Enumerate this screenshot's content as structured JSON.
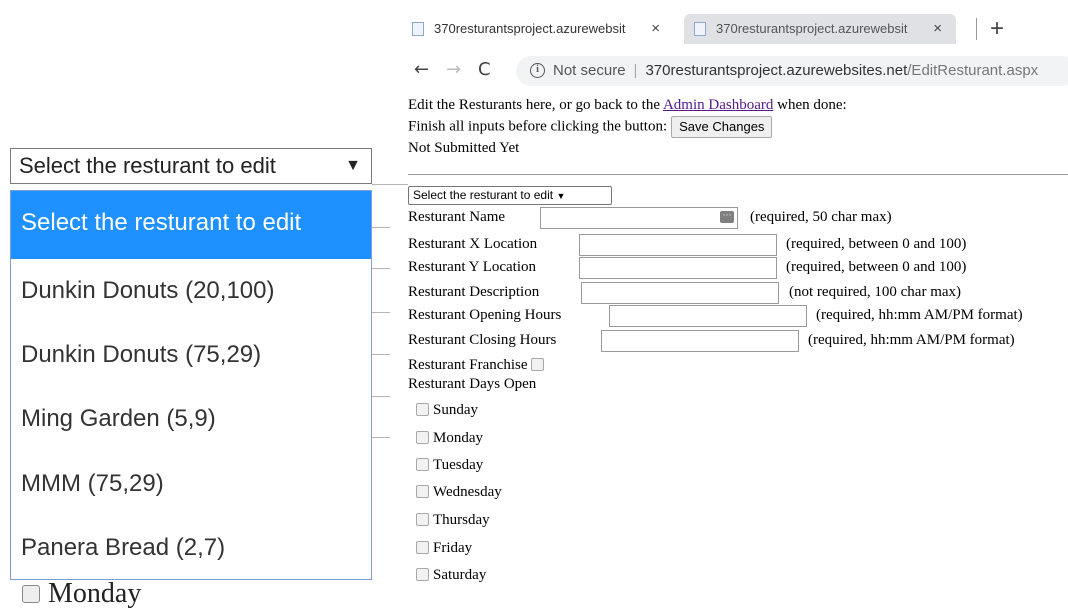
{
  "zoom_panel": {
    "select_value": "Select the resturant to edit",
    "select_arrow": "▼",
    "options": [
      "Select the resturant to edit",
      "Dunkin Donuts (20,100)",
      "Dunkin Donuts (75,29)",
      "Ming Garden (5,9)",
      "MMM (75,29)",
      "Panera Bread (2,7)"
    ],
    "below_label": "Monday"
  },
  "browser": {
    "tabs": [
      {
        "title": "370resturantsproject.azurewebsit",
        "close": "×"
      },
      {
        "title": "370resturantsproject.azurewebsit",
        "close": "×"
      }
    ],
    "new_tab": "+",
    "nav": {
      "back": "←",
      "forward": "→",
      "reload": "C"
    },
    "address": {
      "security": "Not secure",
      "host": "370resturantsproject.azurewebsites.net",
      "path": "/EditResturant.aspx"
    }
  },
  "page": {
    "intro_prefix": "Edit the Resturants here, or go back to the",
    "dashboard_link": "Admin Dashboard",
    "intro_suffix": "when done:",
    "finish_text": "Finish all inputs before clicking the button:",
    "save_button": "Save Changes",
    "status": "Not Submitted Yet",
    "select_value": "Select the resturant to edit",
    "select_arrow": "▼",
    "fields": {
      "name": {
        "label": "Resturant Name",
        "note": "(required, 50 char max)"
      },
      "x_location": {
        "label": "Resturant X Location",
        "note": "(required, between 0 and 100)"
      },
      "y_location": {
        "label": "Resturant Y Location",
        "note": "(required, between 0 and 100)"
      },
      "description": {
        "label": "Resturant Description",
        "note": "(not required, 100 char max)"
      },
      "opening_hours": {
        "label": "Resturant Opening Hours",
        "note": "(required, hh:mm AM/PM format)"
      },
      "closing_hours": {
        "label": "Resturant Closing Hours",
        "note": "(required, hh:mm AM/PM format)"
      }
    },
    "franchise_label": "Resturant Franchise",
    "days_label": "Resturant Days Open",
    "days": [
      "Sunday",
      "Monday",
      "Tuesday",
      "Wednesday",
      "Thursday",
      "Friday",
      "Saturday"
    ]
  }
}
